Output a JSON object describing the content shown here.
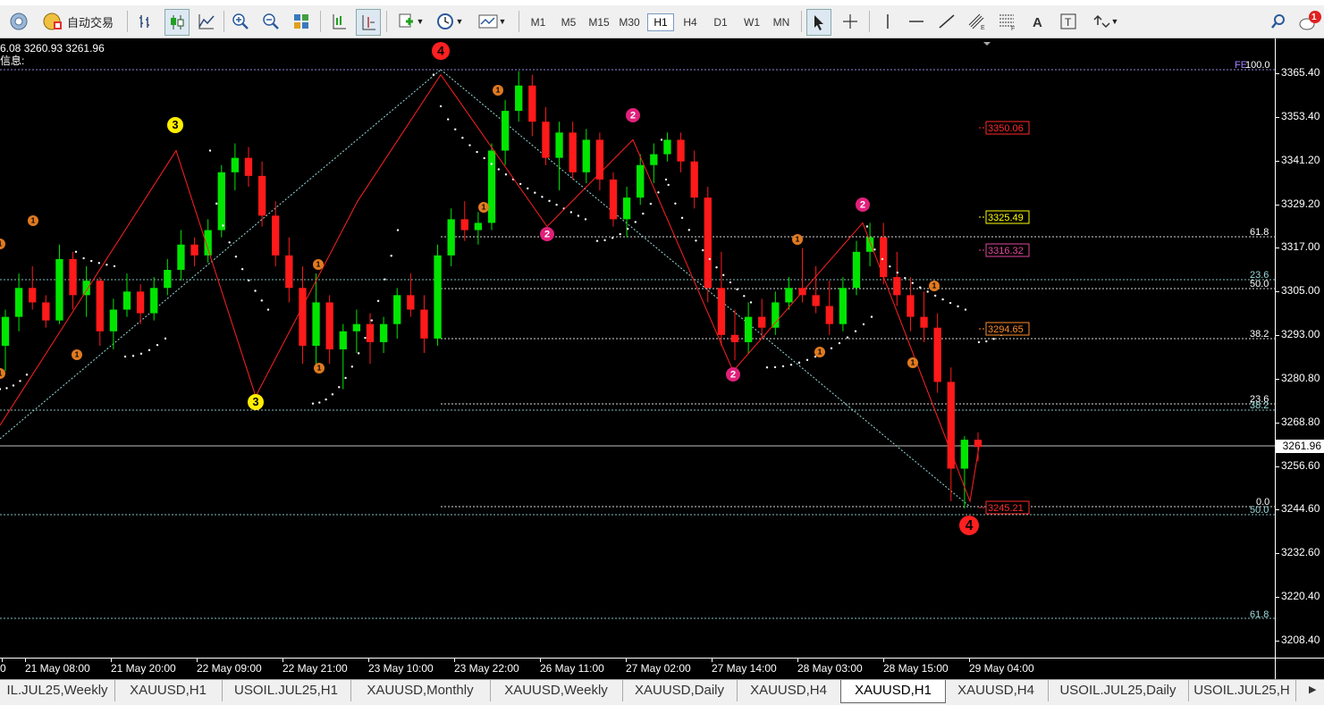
{
  "toolbar": {
    "auto_trade_label": "自动交易",
    "timeframes": [
      "M1",
      "M5",
      "M15",
      "M30",
      "H1",
      "H4",
      "D1",
      "W1",
      "MN"
    ],
    "active_timeframe": "H1",
    "notification_count": "1"
  },
  "info": {
    "line1": "6.08 3260.93 3261.96",
    "line2": "信息:"
  },
  "price_axis": {
    "labels": [
      "3365.40",
      "3353.40",
      "3341.20",
      "3329.20",
      "3317.00",
      "3305.00",
      "3293.00",
      "3280.80",
      "3268.80",
      "3256.60",
      "3244.60",
      "3232.60",
      "3220.40",
      "3208.40"
    ],
    "current_price": "3261.96"
  },
  "time_axis": {
    "labels": [
      "0",
      "21 May 08:00",
      "21 May 20:00",
      "22 May 09:00",
      "22 May 21:00",
      "23 May 10:00",
      "23 May 22:00",
      "26 May 11:00",
      "27 May 02:00",
      "27 May 14:00",
      "28 May 03:00",
      "28 May 15:00",
      "29 May 04:00"
    ]
  },
  "price_tags": [
    {
      "text": "3350.06",
      "color": "#ff2a2a"
    },
    {
      "text": "3325.49",
      "color": "#ffff00"
    },
    {
      "text": "3316.32",
      "color": "#e0489c"
    },
    {
      "text": "3294.65",
      "color": "#ff8c2a"
    },
    {
      "text": "3245.21",
      "color": "#ff2a2a"
    }
  ],
  "fib_labels": {
    "top_fe": "FE",
    "top_100": "100.0",
    "l618": "61.8",
    "l236a": "23.6",
    "l500": "50.0",
    "l382": "38.2",
    "l236b": "23.6",
    "l382b": "38.2",
    "l00": "0.0",
    "l500b": "50.0",
    "l618b": "61.8"
  },
  "wave_labels": [
    "4",
    "3",
    "3",
    "2",
    "2",
    "2",
    "4",
    "1"
  ],
  "tabs": [
    "IL.JUL25,Weekly",
    "XAUUSD,H1",
    "USOIL.JUL25,H1",
    "XAUUSD,Monthly",
    "XAUUSD,Weekly",
    "XAUUSD,Daily",
    "XAUUSD,H4",
    "XAUUSD,H1",
    "XAUUSD,H4",
    "USOIL.JUL25,Daily",
    "USOIL.JUL25,H"
  ],
  "active_tab_index": 7,
  "colors": {
    "bull": "#00e600",
    "bear": "#ff1a1a",
    "psar": "#ffffff",
    "zigzag": "#ff2020"
  },
  "chart_data": {
    "type": "candlestick",
    "symbol": "XAUUSD",
    "timeframe": "H1",
    "ylim": [
      3202,
      3372
    ],
    "candles": [
      [
        3290,
        3300,
        3283,
        3298
      ],
      [
        3298,
        3310,
        3294,
        3306
      ],
      [
        3306,
        3312,
        3300,
        3302
      ],
      [
        3302,
        3304,
        3295,
        3297
      ],
      [
        3297,
        3318,
        3296,
        3314
      ],
      [
        3314,
        3316,
        3300,
        3304
      ],
      [
        3304,
        3312,
        3298,
        3308
      ],
      [
        3308,
        3309,
        3290,
        3294
      ],
      [
        3294,
        3303,
        3289,
        3300
      ],
      [
        3300,
        3310,
        3298,
        3305
      ],
      [
        3305,
        3307,
        3296,
        3299
      ],
      [
        3299,
        3309,
        3297,
        3306
      ],
      [
        3306,
        3314,
        3304,
        3311
      ],
      [
        3311,
        3322,
        3308,
        3318
      ],
      [
        3318,
        3320,
        3312,
        3315
      ],
      [
        3315,
        3325,
        3313,
        3322
      ],
      [
        3322,
        3340,
        3320,
        3338
      ],
      [
        3338,
        3346,
        3333,
        3342
      ],
      [
        3342,
        3345,
        3334,
        3337
      ],
      [
        3337,
        3341,
        3323,
        3326
      ],
      [
        3326,
        3330,
        3312,
        3315
      ],
      [
        3315,
        3320,
        3302,
        3306
      ],
      [
        3306,
        3312,
        3285,
        3290
      ],
      [
        3290,
        3310,
        3283,
        3302
      ],
      [
        3302,
        3304,
        3285,
        3289
      ],
      [
        3289,
        3296,
        3278,
        3294
      ],
      [
        3294,
        3300,
        3288,
        3296
      ],
      [
        3296,
        3299,
        3285,
        3291
      ],
      [
        3291,
        3298,
        3288,
        3296
      ],
      [
        3296,
        3306,
        3292,
        3304
      ],
      [
        3304,
        3310,
        3298,
        3300
      ],
      [
        3300,
        3304,
        3288,
        3292
      ],
      [
        3292,
        3318,
        3290,
        3315
      ],
      [
        3315,
        3328,
        3312,
        3325
      ],
      [
        3325,
        3330,
        3319,
        3322
      ],
      [
        3322,
        3327,
        3318,
        3324
      ],
      [
        3324,
        3346,
        3322,
        3344
      ],
      [
        3344,
        3358,
        3340,
        3355
      ],
      [
        3355,
        3366,
        3352,
        3362
      ],
      [
        3362,
        3365,
        3348,
        3352
      ],
      [
        3352,
        3356,
        3340,
        3342
      ],
      [
        3342,
        3352,
        3333,
        3349
      ],
      [
        3349,
        3352,
        3336,
        3338
      ],
      [
        3338,
        3350,
        3335,
        3347
      ],
      [
        3347,
        3349,
        3333,
        3336
      ],
      [
        3336,
        3338,
        3323,
        3325
      ],
      [
        3325,
        3334,
        3320,
        3331
      ],
      [
        3331,
        3343,
        3329,
        3340
      ],
      [
        3340,
        3346,
        3335,
        3343
      ],
      [
        3343,
        3349,
        3341,
        3347
      ],
      [
        3347,
        3349,
        3338,
        3341
      ],
      [
        3341,
        3344,
        3328,
        3331
      ],
      [
        3331,
        3334,
        3302,
        3306
      ],
      [
        3306,
        3316,
        3290,
        3293
      ],
      [
        3293,
        3300,
        3286,
        3291
      ],
      [
        3291,
        3302,
        3288,
        3298
      ],
      [
        3298,
        3303,
        3292,
        3295
      ],
      [
        3295,
        3305,
        3293,
        3302
      ],
      [
        3302,
        3309,
        3300,
        3306
      ],
      [
        3306,
        3317,
        3302,
        3304
      ],
      [
        3304,
        3312,
        3299,
        3301
      ],
      [
        3301,
        3308,
        3293,
        3296
      ],
      [
        3296,
        3309,
        3294,
        3306
      ],
      [
        3306,
        3319,
        3304,
        3316
      ],
      [
        3316,
        3324,
        3312,
        3320
      ],
      [
        3320,
        3324,
        3307,
        3309
      ],
      [
        3309,
        3316,
        3301,
        3304
      ],
      [
        3304,
        3309,
        3294,
        3298
      ],
      [
        3298,
        3305,
        3291,
        3295
      ],
      [
        3295,
        3299,
        3277,
        3280
      ],
      [
        3280,
        3284,
        3247,
        3256
      ],
      [
        3256,
        3265,
        3245,
        3264
      ],
      [
        3264,
        3266,
        3258,
        3262
      ]
    ]
  }
}
